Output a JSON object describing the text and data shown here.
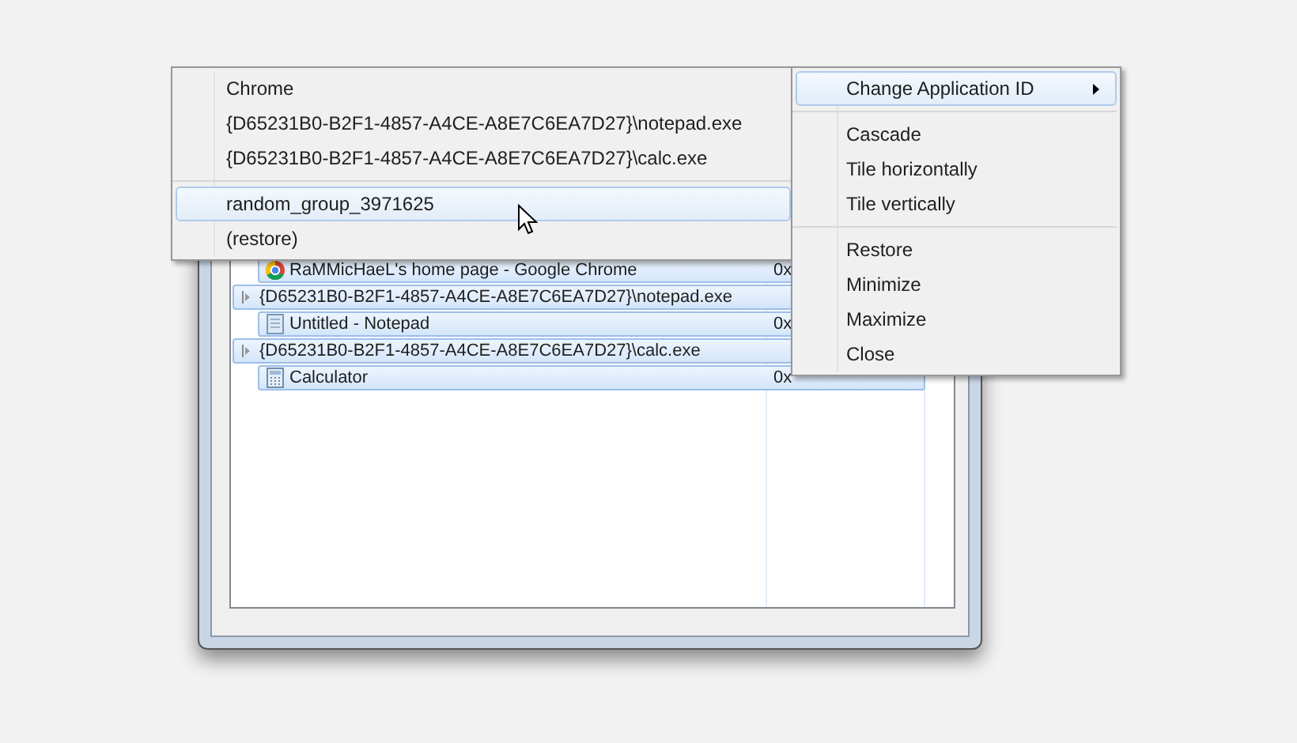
{
  "tree": [
    {
      "children": [
        {
          "kind": "browser",
          "label": "RaMMicHaeL's home page - Google Chrome",
          "value": "0x"
        }
      ]
    },
    {
      "label": "{D65231B0-B2F1-4857-A4CE-A8E7C6EA7D27}\\notepad.exe",
      "children": [
        {
          "kind": "notepad",
          "label": "Untitled - Notepad",
          "value": "0x"
        }
      ]
    },
    {
      "label": "{D65231B0-B2F1-4857-A4CE-A8E7C6EA7D27}\\calc.exe",
      "children": [
        {
          "kind": "calculator",
          "label": "Calculator",
          "value": "0x"
        }
      ]
    }
  ],
  "app_id_menu": {
    "items": [
      {
        "kind": "item",
        "label": "Chrome",
        "selected": false
      },
      {
        "kind": "item",
        "label": "{D65231B0-B2F1-4857-A4CE-A8E7C6EA7D27}\\notepad.exe",
        "selected": false
      },
      {
        "kind": "item",
        "label": "{D65231B0-B2F1-4857-A4CE-A8E7C6EA7D27}\\calc.exe",
        "selected": false
      },
      {
        "kind": "separator"
      },
      {
        "kind": "item",
        "label": "random_group_3971625",
        "selected": true
      },
      {
        "kind": "item",
        "label": "(restore)",
        "selected": false
      }
    ]
  },
  "context_menu": {
    "items": [
      {
        "kind": "submenu",
        "label": "Change Application ID",
        "selected": true
      },
      {
        "kind": "separator"
      },
      {
        "kind": "item",
        "label": "Cascade",
        "selected": false
      },
      {
        "kind": "item",
        "label": "Tile horizontally",
        "selected": false
      },
      {
        "kind": "item",
        "label": "Tile vertically",
        "selected": false
      },
      {
        "kind": "separator"
      },
      {
        "kind": "item",
        "label": "Restore",
        "selected": false
      },
      {
        "kind": "item",
        "label": "Minimize",
        "selected": false
      },
      {
        "kind": "item",
        "label": "Maximize",
        "selected": false
      },
      {
        "kind": "item",
        "label": "Close",
        "selected": false
      }
    ]
  }
}
